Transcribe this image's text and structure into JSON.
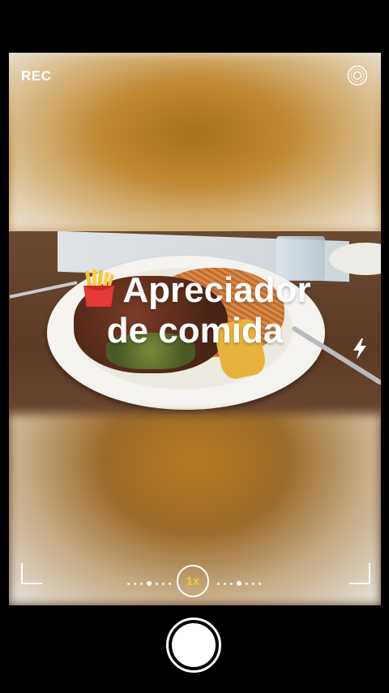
{
  "camera": {
    "rec_label": "REC",
    "caption_line1": "Apreciador",
    "caption_line2": "de comida",
    "caption_emoji": "french-fries-emoji",
    "zoom_label": "1x",
    "accent_color": "#f3c531"
  },
  "icons": {
    "settings": "settings-icon",
    "flash": "flash-icon",
    "shutter": "shutter-button"
  }
}
